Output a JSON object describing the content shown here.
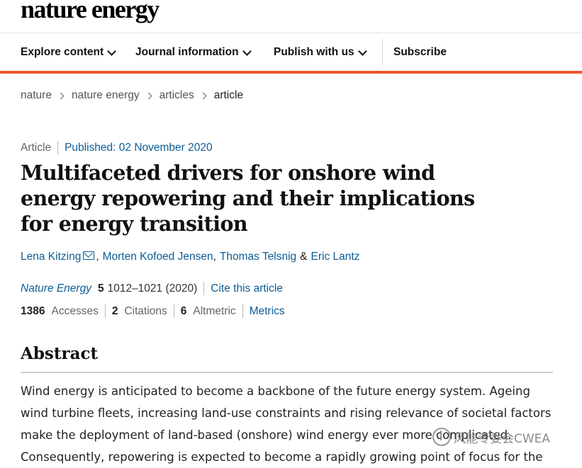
{
  "site": {
    "logo": "nature energy"
  },
  "nav": {
    "items": [
      {
        "label": "Explore content"
      },
      {
        "label": "Journal information"
      },
      {
        "label": "Publish with us"
      }
    ],
    "subscribe": "Subscribe"
  },
  "breadcrumb": [
    "nature",
    "nature energy",
    "articles",
    "article"
  ],
  "article": {
    "type": "Article",
    "published": "Published: 02 November 2020",
    "title": "Multifaceted drivers for onshore wind energy repowering and their implications for energy transition",
    "authors": [
      "Lena Kitzing",
      "Morten Kofoed Jensen",
      "Thomas Telsnig",
      "Eric Lantz"
    ],
    "author_sep_comma": ",",
    "author_sep_amp": "&",
    "journal": "Nature Energy",
    "volume": "5",
    "pages_year": "1012–1021 (2020)",
    "cite": "Cite this article",
    "metrics": {
      "accesses_num": "1386",
      "accesses_label": "Accesses",
      "citations_num": "2",
      "citations_label": "Citations",
      "altmetric_num": "6",
      "altmetric_label": "Altmetric",
      "metrics_link": "Metrics"
    }
  },
  "abstract": {
    "heading": "Abstract",
    "text": "Wind energy is anticipated to become a backbone of the future energy system. Ageing wind turbine fleets, increasing land-use constraints and rising relevance of societal factors make the deployment of land-based (onshore) wind energy ever more complicated. Consequently, repowering is expected to become a rapidly growing point of focus for the"
  },
  "watermark": {
    "text": "风能专委会CWEA",
    "icon": "wechat-logo-icon"
  },
  "colors": {
    "accent": "#e9582c",
    "link": "#0c5c95"
  }
}
